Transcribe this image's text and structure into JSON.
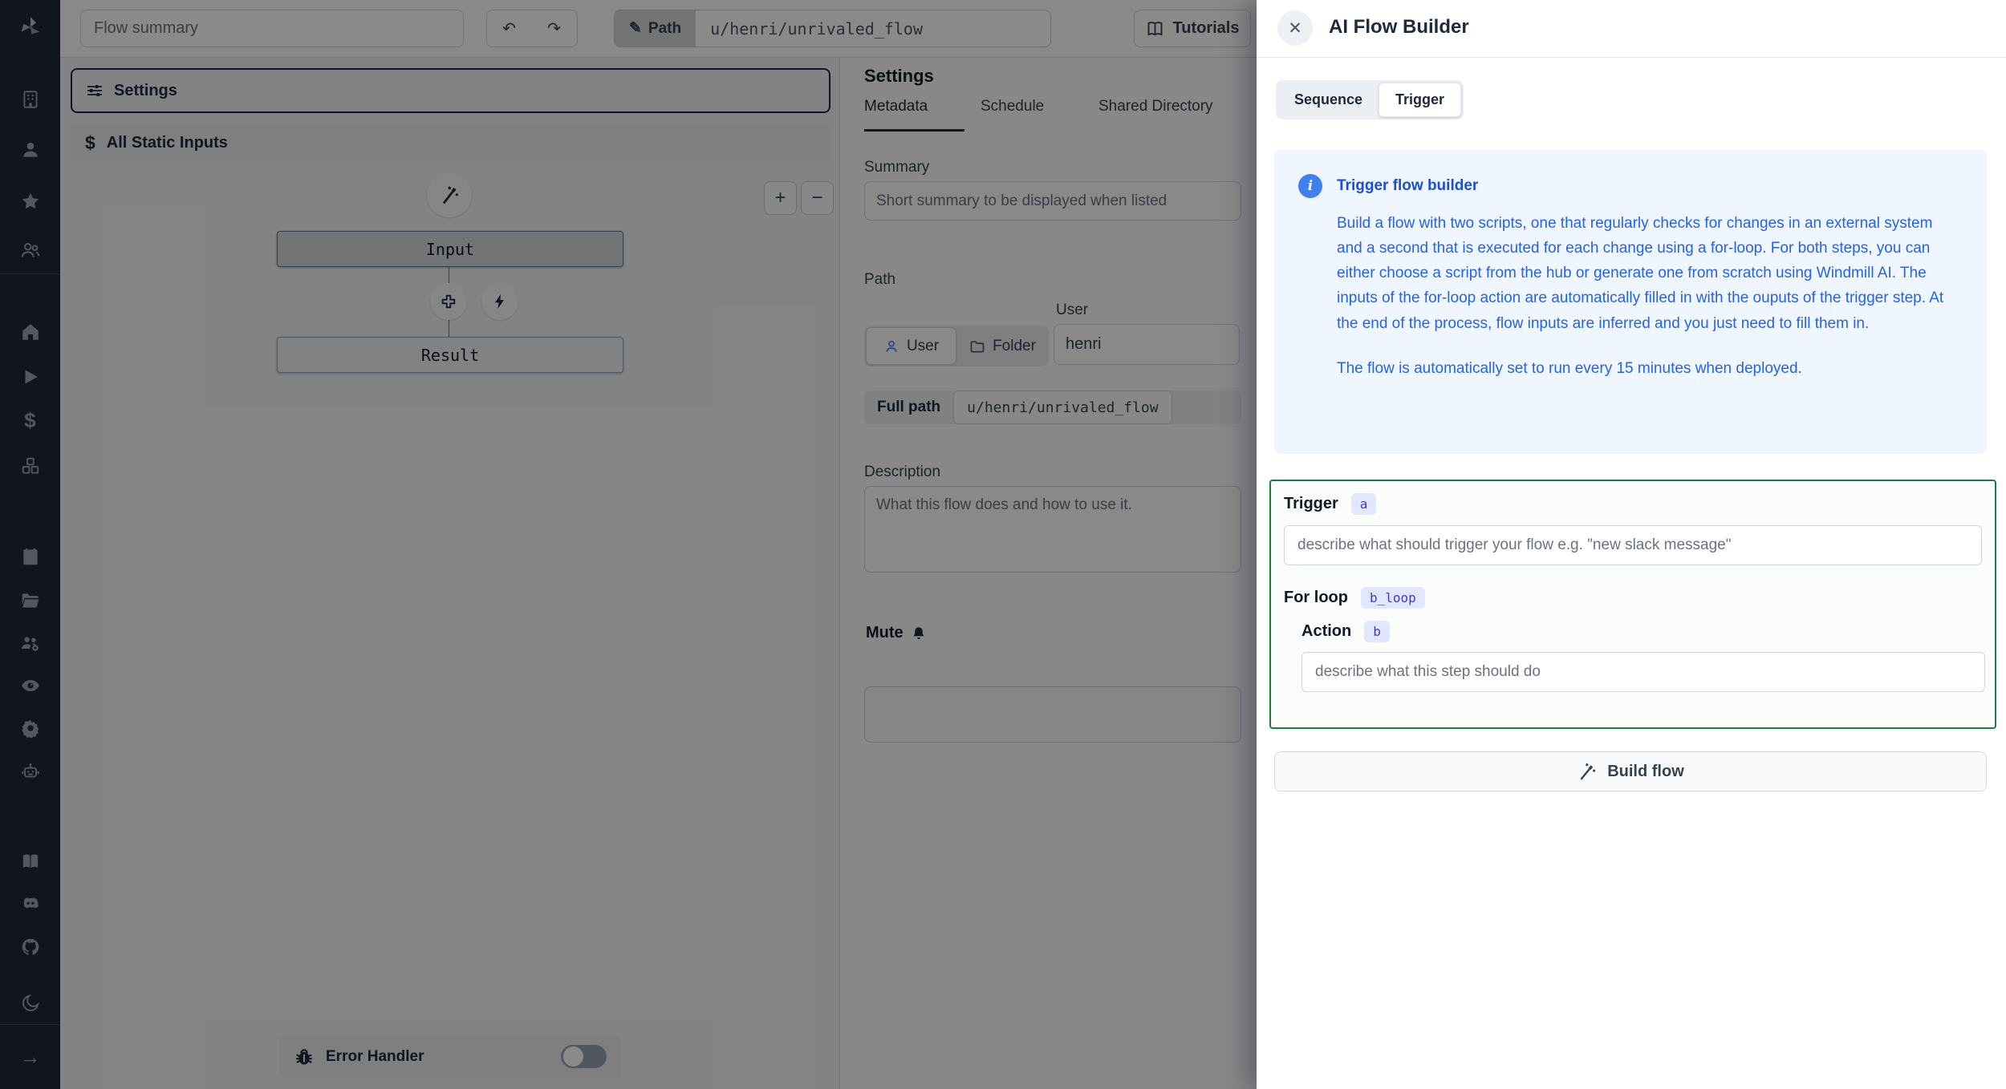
{
  "topbar": {
    "flow_summary_placeholder": "Flow summary",
    "path_button_label": "Path",
    "path_value": "u/henri/unrivaled_flow",
    "tutorials_label": "Tutorials"
  },
  "flow_panel": {
    "settings_button": "Settings",
    "all_static_inputs": "All Static Inputs",
    "input_node": "Input",
    "result_node": "Result",
    "error_handler_label": "Error Handler"
  },
  "settings_panel": {
    "title": "Settings",
    "tabs": [
      {
        "label": "Metadata",
        "active": true
      },
      {
        "label": "Schedule",
        "active": false
      },
      {
        "label": "Shared Directory",
        "active": false
      }
    ],
    "summary_label": "Summary",
    "summary_placeholder": "Short summary to be displayed when listed",
    "path_label": "Path",
    "user_field_label": "User",
    "owner_user_label": "User",
    "owner_folder_label": "Folder",
    "user_value": "henri",
    "full_path_label": "Full path",
    "full_path_value": "u/henri/unrivaled_flow",
    "description_label": "Description",
    "description_placeholder": "What this flow does and how to use it.",
    "mute_label": "Mute"
  },
  "ai_panel": {
    "title": "AI Flow Builder",
    "tab_sequence": "Sequence",
    "tab_trigger": "Trigger",
    "info": {
      "title": "Trigger flow builder",
      "body": "Build a flow with two scripts, one that regularly checks for changes in an external system and a second that is executed for each change using a for-loop. For both steps, you can either choose a script from the hub or generate one from scratch using Windmill AI. The inputs of the for-loop action are automatically filled in with the ouputs of the trigger step. At the end of the process, flow inputs are inferred and you just need to fill them in.",
      "footer": "The flow is automatically set to run every 15 minutes when deployed."
    },
    "builder": {
      "trigger_label": "Trigger",
      "trigger_badge": "a",
      "trigger_placeholder": "describe what should trigger your flow e.g. \"new slack message\"",
      "forloop_label": "For loop",
      "forloop_badge": "b_loop",
      "action_label": "Action",
      "action_badge": "b",
      "action_placeholder": "describe what this step should do"
    },
    "build_button": "Build flow"
  },
  "icons": {
    "undo": "↶",
    "redo": "↷",
    "pencil": "✎",
    "close": "✕",
    "plus": "+",
    "minus": "−",
    "dollar": "$",
    "arrow_right": "→",
    "info": "i"
  },
  "colors": {
    "sidebar_bg": "#212836",
    "accent_blue": "#2563eb",
    "info_bg": "#eff6ff",
    "green_border": "#15803d",
    "badge_bg": "#e0e7ff",
    "badge_text": "#4338ca"
  }
}
